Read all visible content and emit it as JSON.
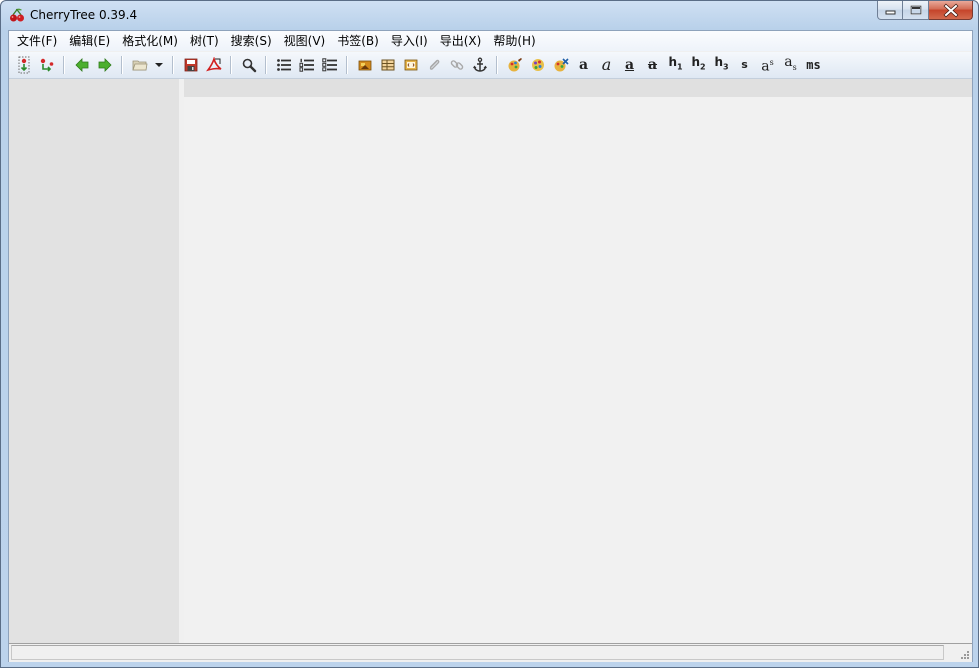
{
  "window": {
    "title": "CherryTree 0.39.4",
    "app_icon": "cherry-icon",
    "caption_buttons": [
      "minimize-icon",
      "maximize-icon",
      "close-icon"
    ]
  },
  "menubar": {
    "items": [
      {
        "label": "文件(F)"
      },
      {
        "label": "编辑(E)"
      },
      {
        "label": "格式化(M)"
      },
      {
        "label": "树(T)"
      },
      {
        "label": "搜索(S)"
      },
      {
        "label": "视图(V)"
      },
      {
        "label": "书签(B)"
      },
      {
        "label": "导入(I)"
      },
      {
        "label": "导出(X)"
      },
      {
        "label": "帮助(H)"
      }
    ]
  },
  "toolbar": {
    "text_buttons": {
      "bold": "a",
      "italic": "a",
      "underline": "a",
      "strike": "a",
      "h1": "h",
      "h1_sub": "1",
      "h2": "h",
      "h2_sub": "2",
      "h3": "h",
      "h3_sub": "3",
      "small": "s",
      "superscript": "a",
      "superscript_mark": "s",
      "subscript": "a",
      "subscript_mark": "s",
      "monospace": "ms"
    },
    "icons": [
      "add-node-icon",
      "add-subnode-icon",
      "back-arrow-icon",
      "forward-arrow-icon",
      "open-folder-icon",
      "dropdown-arrow-icon",
      "save-icon",
      "export-pdf-icon",
      "search-icon",
      "bulleted-list-icon",
      "numbered-list-icon",
      "todo-list-icon",
      "insert-image-icon",
      "insert-table-icon",
      "insert-codebox-icon",
      "attach-file-icon",
      "insert-link-icon",
      "insert-anchor-icon",
      "text-color-icon",
      "highlight-color-icon",
      "clear-format-icon"
    ]
  },
  "statusbar": {
    "text": ""
  },
  "colors": {
    "accent": "#c5442a",
    "tree_pane_bg": "#e2e2e2",
    "editor_bg": "#f1f1f1"
  }
}
